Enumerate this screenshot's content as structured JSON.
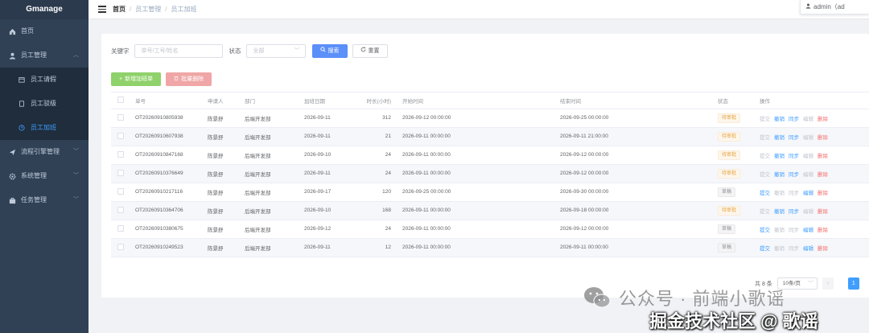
{
  "app": {
    "title": "Gmanage"
  },
  "sidebar": {
    "items": [
      {
        "label": "首页",
        "icon": "home-icon"
      },
      {
        "label": "员工管理",
        "icon": "user-icon",
        "expanded": true,
        "children": [
          {
            "label": "员工请假",
            "icon": "calendar-icon"
          },
          {
            "label": "员工驳级",
            "icon": "document-icon"
          },
          {
            "label": "员工加班",
            "icon": "clock-icon",
            "active": true
          }
        ]
      },
      {
        "label": "流程引擎管理",
        "icon": "send-icon"
      },
      {
        "label": "系统管理",
        "icon": "gear-icon"
      },
      {
        "label": "任务管理",
        "icon": "briefcase-icon"
      }
    ]
  },
  "header": {
    "breadcrumb": [
      "首页",
      "员工管理",
      "员工加班"
    ],
    "user": "admin（ad"
  },
  "filters": {
    "keyword_label": "关键字",
    "keyword_placeholder": "单号/工号/姓名",
    "status_label": "状态",
    "status_placeholder": "全部",
    "search_label": "搜索",
    "reset_label": "重置"
  },
  "actions": {
    "add_label": "新增加班单",
    "batch_delete_label": "批量删除"
  },
  "table": {
    "columns": [
      "单号",
      "申请人",
      "部门",
      "加班日期",
      "时长(小时)",
      "开始时间",
      "结束时间",
      "状态",
      "操作"
    ],
    "rows": [
      {
        "no": "OT20260910805938",
        "applicant": "陈景舒",
        "dept": "后端开发部",
        "date": "2026-09-11",
        "hours": "312",
        "start": "2026-09-12 00:00:00",
        "end": "2026-09-25 00:00:00",
        "status": "待审批",
        "status_type": "pending"
      },
      {
        "no": "OT20260910607938",
        "applicant": "陈景舒",
        "dept": "后端开发部",
        "date": "2026-09-11",
        "hours": "21",
        "start": "2026-09-11 00:00:00",
        "end": "2026-09-11 21:00:00",
        "status": "待审批",
        "status_type": "pending"
      },
      {
        "no": "OT20260910847168",
        "applicant": "陈景舒",
        "dept": "后端开发部",
        "date": "2026-09-10",
        "hours": "24",
        "start": "2026-09-11 00:00:00",
        "end": "2026-09-12 00:00:00",
        "status": "待审批",
        "status_type": "pending"
      },
      {
        "no": "OT20260910376649",
        "applicant": "陈景舒",
        "dept": "后端开发部",
        "date": "2026-09-11",
        "hours": "24",
        "start": "2026-09-11 00:00:00",
        "end": "2026-09-12 00:00:00",
        "status": "待审批",
        "status_type": "pending"
      },
      {
        "no": "OT20260910217116",
        "applicant": "陈景舒",
        "dept": "后端开发部",
        "date": "2026-09-17",
        "hours": "120",
        "start": "2026-09-25 00:00:00",
        "end": "2026-09-30 00:00:00",
        "status": "草稿",
        "status_type": "draft"
      },
      {
        "no": "OT20260910364706",
        "applicant": "陈景舒",
        "dept": "后端开发部",
        "date": "2026-09-10",
        "hours": "168",
        "start": "2026-09-11 00:00:00",
        "end": "2026-09-18 00:00:00",
        "status": "待审批",
        "status_type": "pending"
      },
      {
        "no": "OT20260910380675",
        "applicant": "陈景舒",
        "dept": "后端开发部",
        "date": "2026-09-12",
        "hours": "24",
        "start": "2026-09-11 00:00:00",
        "end": "2026-09-12 00:00:00",
        "status": "草稿",
        "status_type": "draft"
      },
      {
        "no": "OT20260910249523",
        "applicant": "陈景舒",
        "dept": "后端开发部",
        "date": "2026-09-11",
        "hours": "12",
        "start": "2026-09-11 00:00:00",
        "end": "2026-09-11 00:00:00",
        "status": "草稿",
        "status_type": "draft"
      }
    ],
    "operations": [
      "提交",
      "撤销",
      "同步",
      "编辑",
      "删除"
    ]
  },
  "pagination": {
    "total_text": "共 8 条",
    "page_size": "10条/页",
    "prev": "‹",
    "current": "1"
  },
  "watermark": {
    "line1": "公众号 · 前端小歌谣",
    "line2": "掘金技术社区 @ 歌谣"
  },
  "colors": {
    "sidebar_bg": "#304156",
    "accent": "#409eff",
    "pending": "#e6a23c",
    "danger": "#f56c6c",
    "success": "#8fd16a"
  }
}
